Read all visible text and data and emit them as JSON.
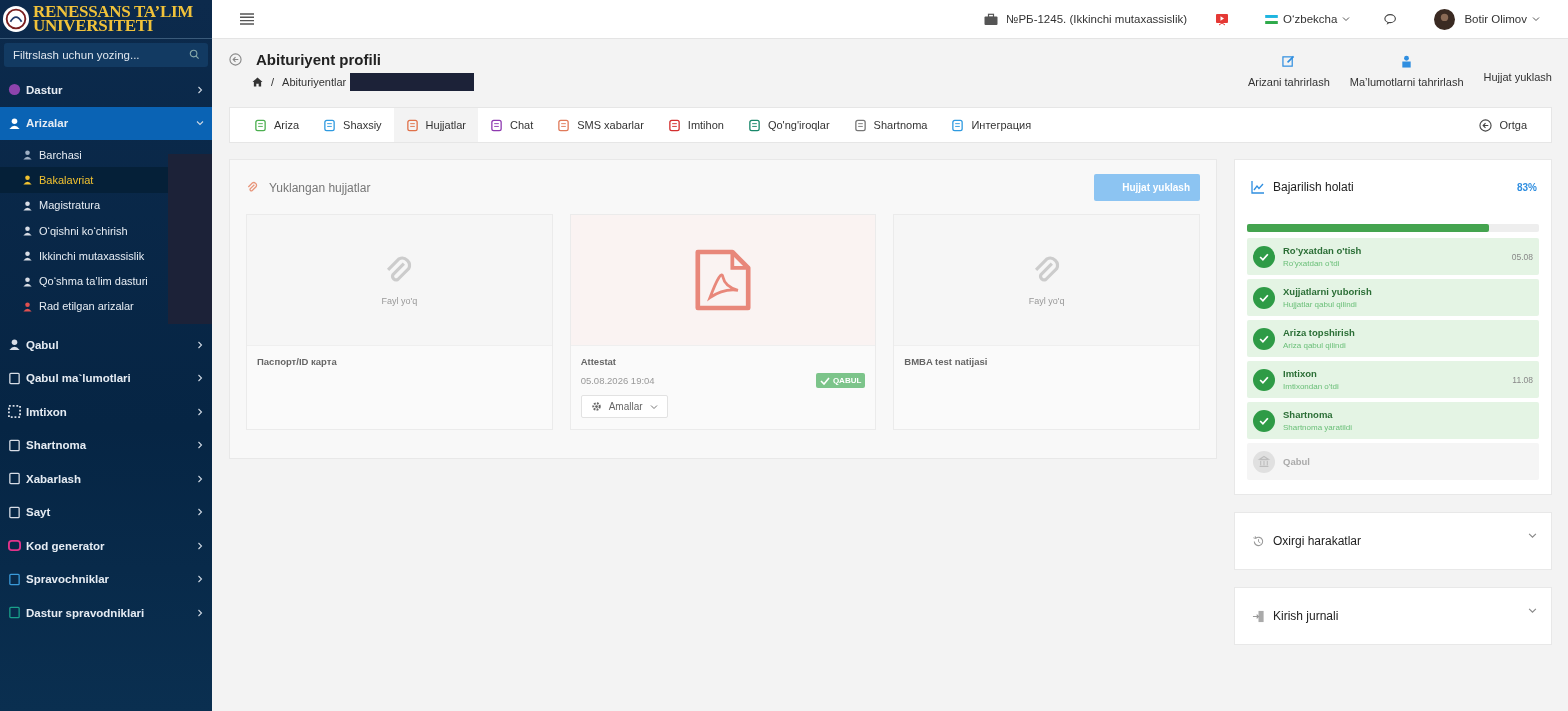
{
  "logo": {
    "lines": [
      "RENESSANS TA’LIM",
      "UNIVERSITETI"
    ]
  },
  "sidebar": {
    "search": {
      "placeholder": "Filtrslash uchun yozing..."
    },
    "items": [
      {
        "label": "Dastur",
        "expanded": false,
        "selected": false
      },
      {
        "label": "Arizalar",
        "expanded": true,
        "selected": true,
        "children": [
          {
            "label": "Barchasi",
            "selected": false
          },
          {
            "label": "Bakalavriat",
            "selected": true
          },
          {
            "label": "Magistratura",
            "selected": false
          },
          {
            "label": "O‘qishni ko‘chirish",
            "selected": false
          },
          {
            "label": "Ikkinchi mutaxassislik",
            "selected": false
          },
          {
            "label": "Qo‘shma ta’lim dasturi",
            "selected": false
          },
          {
            "label": "Rad etilgan arizalar",
            "selected": false
          }
        ]
      },
      {
        "label": "Qabul",
        "expanded": false,
        "selected": false
      },
      {
        "label": "Qabul ma`lumotlari",
        "expanded": false,
        "selected": false
      },
      {
        "label": "Imtixon",
        "expanded": false,
        "selected": false
      },
      {
        "label": "Shartnoma",
        "expanded": false,
        "selected": false
      },
      {
        "label": "Xabarlash",
        "expanded": false,
        "selected": false
      },
      {
        "label": "Sayt",
        "expanded": false,
        "selected": false
      },
      {
        "label": "Kod generator",
        "expanded": false,
        "selected": false
      },
      {
        "label": "Spravochniklar",
        "expanded": false,
        "selected": false
      },
      {
        "label": "Dastur spravodniklari",
        "expanded": false,
        "selected": false
      }
    ]
  },
  "topbar": {
    "branch": "№РБ-1245. (Ikkinchi mutaxassislik)",
    "language": "O‘zbekcha",
    "user": "Botir Olimov"
  },
  "header": {
    "title": "Abituriyent profili",
    "breadcrumb_separator": "/",
    "breadcrumb": [
      "Abituriyentlar"
    ],
    "actions": [
      "Arizani tahrirlash",
      "Ma’lumotlarni tahrirlash",
      "Hujjat yuklash"
    ]
  },
  "tabs": [
    {
      "label": "Ariza",
      "selected": false
    },
    {
      "label": "Shaxsiy",
      "selected": false
    },
    {
      "label": "Hujjatlar",
      "selected": true
    },
    {
      "label": "Chat",
      "selected": false
    },
    {
      "label": "SMS xabarlar",
      "selected": false
    },
    {
      "label": "Imtihon",
      "selected": false
    },
    {
      "label": "Qo'ng'iroqlar",
      "selected": false
    },
    {
      "label": "Shartnoma",
      "selected": false
    },
    {
      "label": "Интеграция",
      "selected": false
    }
  ],
  "back_button": "Ortga",
  "documents": {
    "title": "Yuklangan hujjatlar",
    "upload_button": "Hujjat yuklash",
    "cards": [
      {
        "kind": "empty",
        "empty_text": "Fayl yo'q",
        "name": "Паспорт/ID карта"
      },
      {
        "kind": "pdf",
        "name": "Attestat",
        "date": "05.08.2026 19:04",
        "status": "QABUL",
        "menu": "Amallar"
      },
      {
        "kind": "empty",
        "empty_text": "Fayl yo'q",
        "name": "BMBA test natijasi"
      }
    ]
  },
  "progress": {
    "title": "Bajarilish holati",
    "percent": "83%",
    "level": 0.83,
    "steps": [
      {
        "title": "Ro'yxatdan o'tish",
        "subtitle": "Ro'yxatdan o'tdi",
        "date": "05.08",
        "done": true
      },
      {
        "title": "Xujjatlarni yuborish",
        "subtitle": "Hujjatlar qabul qilindi",
        "done": true
      },
      {
        "title": "Ariza topshirish",
        "subtitle": "Ariza qabul qilindi",
        "done": true
      },
      {
        "title": "Imtixon",
        "subtitle": "Imtixondan o'tdi",
        "date": "11.08",
        "done": true
      },
      {
        "title": "Shartnoma",
        "subtitle": "Shartnoma yaratildi",
        "done": true
      },
      {
        "title": "Qabul",
        "done": false
      }
    ]
  },
  "panels": [
    {
      "title": "Oxirgi harakatlar",
      "expanded": false
    },
    {
      "title": "Kirish jurnali",
      "expanded": false
    }
  ]
}
